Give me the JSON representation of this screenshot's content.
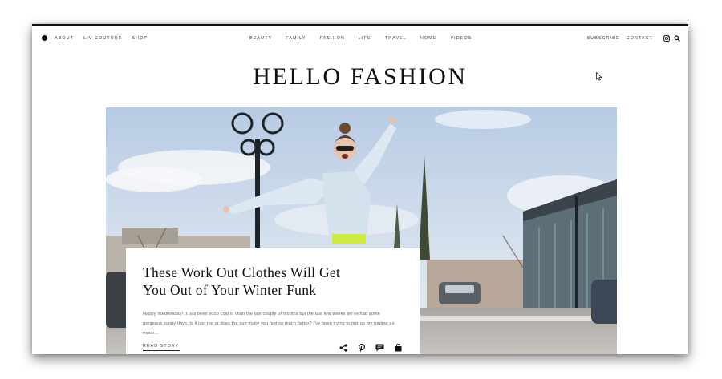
{
  "nav": {
    "left": [
      "About",
      "Liv Couture",
      "Shop"
    ],
    "center": [
      "Beauty",
      "Family",
      "Fashion",
      "Life",
      "Travel",
      "Home",
      "Videos"
    ],
    "right": [
      "Subscribe",
      "Contact"
    ],
    "icons": [
      "instagram-icon",
      "search-icon"
    ]
  },
  "site": {
    "title": "HELLO FASHION"
  },
  "hero": {
    "image_desc_icon": "hero-photo"
  },
  "featured": {
    "title_line1": "These Work Out Clothes Will Get",
    "title_line2": "You Out of Your Winter Funk",
    "excerpt": "Happy Wednesday! It has been sooo cold in Utah the last couple of months but the last few weeks we've had some gorgeous sunny days. Is it just me or does the sun make you feel so much better? I've been trying to mix up my routine as much…",
    "read_more": "Read Story",
    "actions": [
      "share-icon",
      "pinterest-icon",
      "comment-icon",
      "shopping-bag-icon"
    ]
  },
  "colors": {
    "text": "#111111",
    "sky": "#c9d8ea",
    "road": "#b9b6b2"
  }
}
